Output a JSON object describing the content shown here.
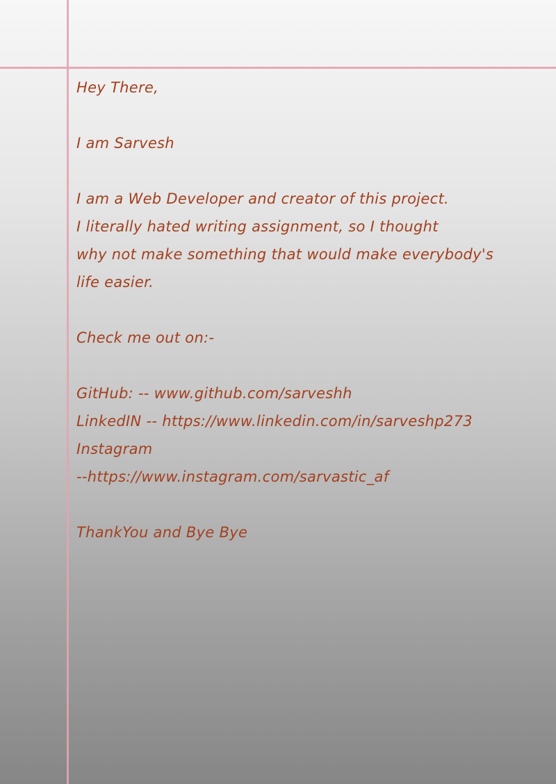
{
  "letter": {
    "greeting": "Hey There,",
    "intro": "I am  Sarvesh",
    "body": [
      "I am a Web Developer and creator of this project.",
      "I literally hated writing assignment, so I thought",
      "why not make something that would make everybody's",
      "life easier."
    ],
    "check_out": "Check me out on:-",
    "links": [
      "GitHub: -- www.github.com/sarveshh",
      "LinkedIN -- https://www.linkedin.com/in/sarveshp273",
      "Instagram",
      "--https://www.instagram.com/sarvastic_af"
    ],
    "closing": "ThankYou and Bye Bye"
  },
  "colors": {
    "ink": "#a3401f",
    "margin": "#e2a4b2",
    "rule": "#5a5a5a"
  }
}
